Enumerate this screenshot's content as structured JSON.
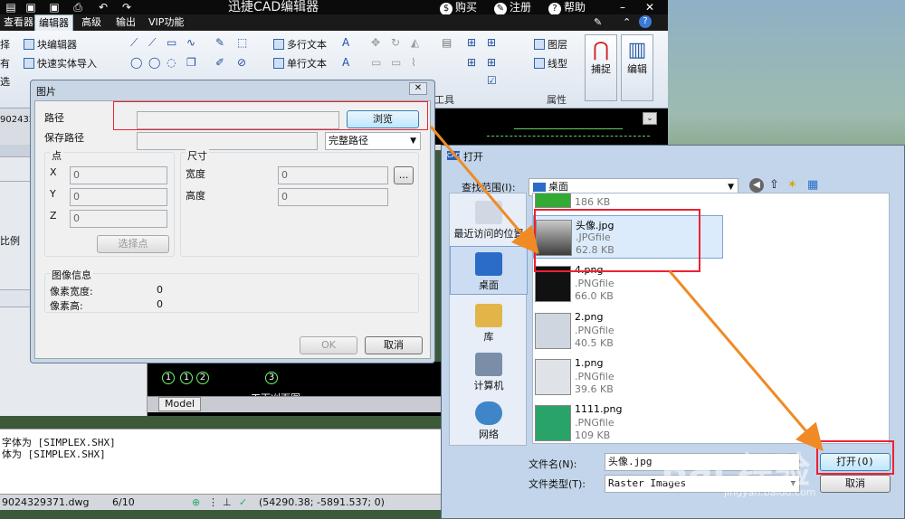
{
  "cad": {
    "title": "迅捷CAD编辑器",
    "buy": "购买",
    "register": "注册",
    "help": "帮助",
    "tabs": [
      "查看器",
      "编辑器",
      "高级",
      "输出",
      "VIP功能"
    ],
    "active_tab": "编辑器",
    "ribbon": {
      "block_editor": "块编辑器",
      "quick_import": "快速实体导入",
      "left_edge_1": "择",
      "left_edge_2": "有",
      "left_edge_3": "选",
      "multiline_text": "多行文本",
      "singleline_text": "单行文本",
      "layer": "图层",
      "linetype": "线型",
      "snap": "捕捉",
      "edit": "编辑",
      "group_properties": "属性",
      "group_tools": "工具"
    },
    "left_panel": {
      "id_fragment": "902432",
      "scale_label": "比例"
    },
    "drawing": {
      "tab": "Model",
      "labels": [
        "1",
        "2",
        "3"
      ],
      "caption": "工下刈面图"
    },
    "command_lines": [
      "字体为 [SIMPLEX.SHX]",
      "体为 [SIMPLEX.SHX]"
    ],
    "status": {
      "file": "9024329371.dwg",
      "page": "6/10",
      "coords": "(54290.38; -5891.537; 0)"
    }
  },
  "image_dialog": {
    "title": "图片",
    "path_label": "路径",
    "path_value": "",
    "browse": "浏览",
    "save_path_label": "保存路径",
    "save_path_option": "完整路径",
    "point_group": "点",
    "x_label": "X",
    "y_label": "Y",
    "z_label": "Z",
    "x_value": "0",
    "y_value": "0",
    "z_value": "0",
    "pick_point": "选择点",
    "size_group": "尺寸",
    "width_label": "宽度",
    "height_label": "高度",
    "width_value": "0",
    "height_value": "0",
    "ellipsis": "...",
    "info_group": "图像信息",
    "px_width_label": "像素宽度:",
    "px_height_label": "像素高:",
    "px_width_value": "0",
    "px_height_value": "0",
    "ok": "OK",
    "cancel": "取消"
  },
  "open_dialog": {
    "title": "打开",
    "look_in_label": "查找范围(I):",
    "look_in_value": "桌面",
    "places": [
      "最近访问的位置",
      "桌面",
      "库",
      "计算机",
      "网络"
    ],
    "active_place": "桌面",
    "files": [
      {
        "name": "",
        "type": "",
        "size": "186 KB"
      },
      {
        "name": "头像.jpg",
        "type": ".JPGfile",
        "size": "62.8 KB"
      },
      {
        "name": "4.png",
        "type": ".PNGfile",
        "size": "66.0 KB"
      },
      {
        "name": "2.png",
        "type": ".PNGfile",
        "size": "40.5 KB"
      },
      {
        "name": "1.png",
        "type": ".PNGfile",
        "size": "39.6 KB"
      },
      {
        "name": "1111.png",
        "type": ".PNGfile",
        "size": "109 KB"
      }
    ],
    "selected_file": "头像.jpg",
    "filename_label": "文件名(N):",
    "filename_value": "头像.jpg",
    "filetype_label": "文件类型(T):",
    "filetype_value": "Raster Images",
    "open_button": "打开(O)",
    "cancel_button": "取消"
  },
  "watermark": {
    "text": "Bai 经验",
    "url": "jingyan.baidu.com"
  },
  "colors": {
    "annotation_red": "#e22233",
    "arrow_orange": "#f08a24",
    "selection_blue": "#dcebfc"
  }
}
